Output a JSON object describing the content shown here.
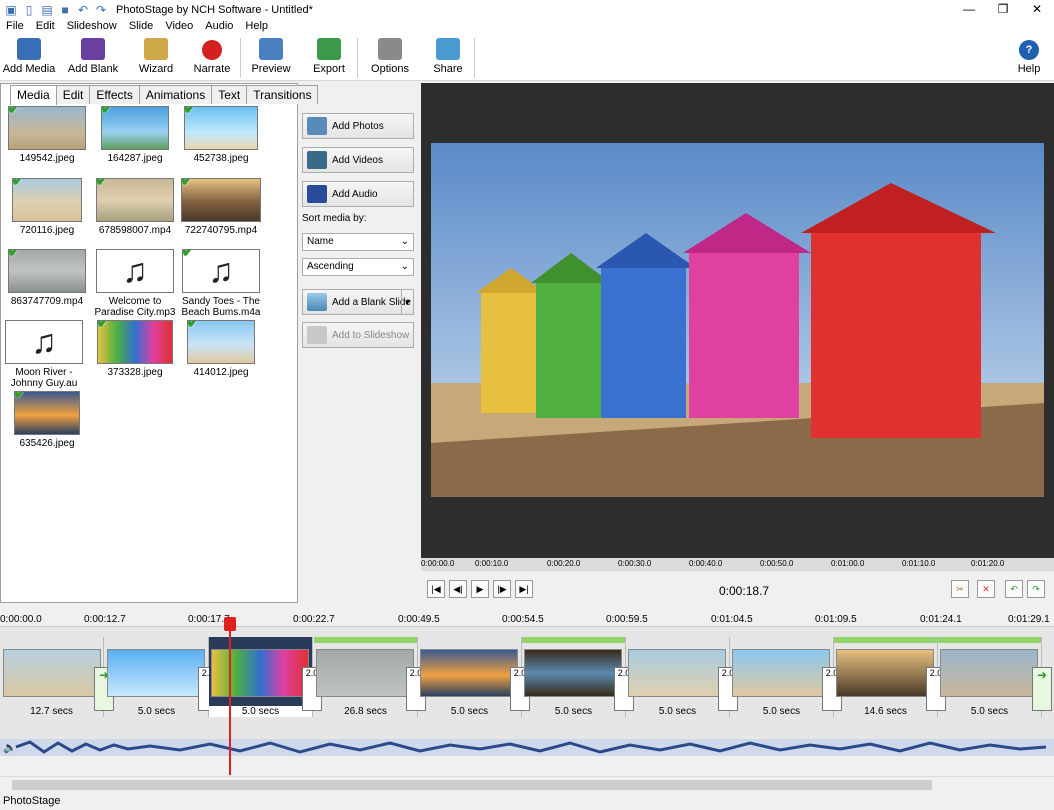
{
  "window": {
    "title": "PhotoStage by NCH Software - Untitled*"
  },
  "menu": [
    "File",
    "Edit",
    "Slideshow",
    "Slide",
    "Video",
    "Audio",
    "Help"
  ],
  "toolbar": {
    "add_media": "Add Media",
    "add_blank": "Add Blank",
    "wizard": "Wizard",
    "narrate": "Narrate",
    "preview": "Preview",
    "export": "Export",
    "options": "Options",
    "share": "Share",
    "help": "Help"
  },
  "tabs": [
    "Media",
    "Edit",
    "Effects",
    "Animations",
    "Text",
    "Transitions"
  ],
  "media": [
    {
      "name": "149542.jpeg",
      "type": "image",
      "checked": true
    },
    {
      "name": "164287.jpeg",
      "type": "image",
      "checked": true
    },
    {
      "name": "452738.jpeg",
      "type": "image",
      "checked": true
    },
    {
      "name": "720116.jpeg",
      "type": "image",
      "checked": true
    },
    {
      "name": "678598007.mp4",
      "type": "video",
      "checked": true
    },
    {
      "name": "722740795.mp4",
      "type": "video",
      "checked": true
    },
    {
      "name": "863747709.mp4",
      "type": "video",
      "checked": true
    },
    {
      "name": "Welcome to Paradise City.mp3",
      "type": "audio",
      "checked": false
    },
    {
      "name": "Sandy Toes - The Beach Bums.m4a",
      "type": "audio",
      "checked": true
    },
    {
      "name": "Moon River - Johnny Guy.au",
      "type": "audio",
      "checked": false
    },
    {
      "name": "373328.jpeg",
      "type": "image",
      "checked": true
    },
    {
      "name": "414012.jpeg",
      "type": "image",
      "checked": true
    },
    {
      "name": "635426.jpeg",
      "type": "image",
      "checked": true
    }
  ],
  "side": {
    "add_photos": "Add Photos",
    "add_videos": "Add Videos",
    "add_audio": "Add Audio",
    "sort_label": "Sort media by:",
    "sort_value": "Name",
    "order_value": "Ascending",
    "add_blank_slide": "Add a Blank Slide",
    "add_to_slideshow": "Add to Slideshow"
  },
  "preview_ruler": [
    "0:00:00.0",
    "0:00:10.0",
    "0:00:20.0",
    "0:00:30.0",
    "0:00:40.0",
    "0:00:50.0",
    "0:01:00.0",
    "0:01:10.0",
    "0:01:20.0"
  ],
  "player": {
    "timecode": "0:00:18.7"
  },
  "timeline_ruler": [
    "0:00:00.0",
    "0:00:12.7",
    "0:00:17.7",
    "0:00:22.7",
    "0:00:49.5",
    "0:00:54.5",
    "0:00:59.5",
    "0:01:04.5",
    "0:01:09.5",
    "0:01:24.1",
    "0:01:29.1"
  ],
  "clips": [
    {
      "dur": "12.7 secs",
      "tr": ""
    },
    {
      "dur": "5.0 secs",
      "tr": "2.0"
    },
    {
      "dur": "5.0 secs",
      "tr": "2.0"
    },
    {
      "dur": "26.8 secs",
      "tr": "2.0"
    },
    {
      "dur": "5.0 secs",
      "tr": "2.0"
    },
    {
      "dur": "5.0 secs",
      "tr": "2.0"
    },
    {
      "dur": "5.0 secs",
      "tr": "2.0"
    },
    {
      "dur": "5.0 secs",
      "tr": "2.0"
    },
    {
      "dur": "14.6 secs",
      "tr": "2.0"
    },
    {
      "dur": "5.0 secs",
      "tr": ""
    }
  ],
  "status": "PhotoStage",
  "colors": {
    "accent": "#3a6fb8",
    "playhead": "#e02020",
    "check": "#2ca02c",
    "clip_bar": "#8fd36a"
  }
}
